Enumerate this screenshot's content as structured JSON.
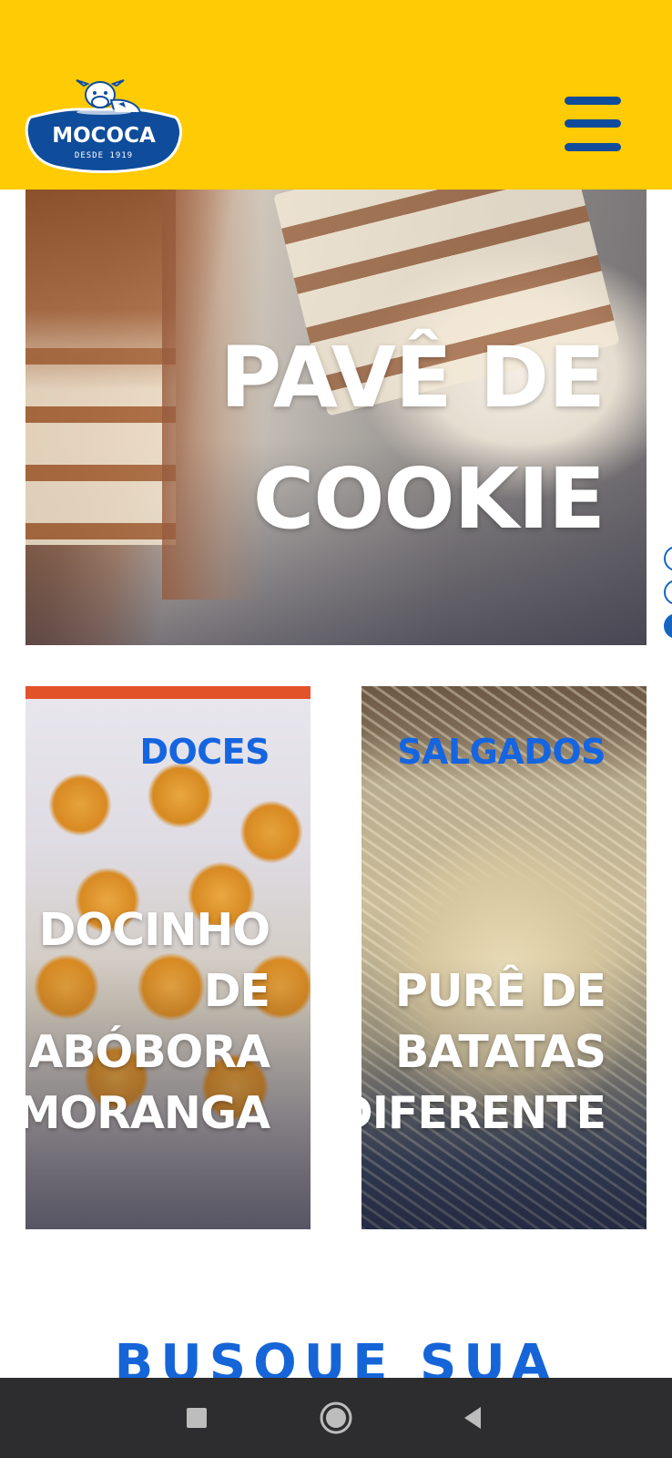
{
  "header": {
    "logo": {
      "brand": "MOCOCA",
      "tagline": "DESDE 1919",
      "icon": "cow-mascot-icon"
    },
    "menu_icon": "hamburger-menu-icon",
    "background_color": "#FFCB05",
    "accent_color": "#0F4C9B"
  },
  "hero": {
    "title": "PAVÊ DE COOKIE",
    "slider": {
      "total_dots": 3,
      "active_index": 2,
      "color": "#1565C0"
    }
  },
  "categories": [
    {
      "category": "DOCES",
      "title": "DOCINHO\nDE\nABÓBORA\nMORANGA"
    },
    {
      "category": "SALGADOS",
      "title": "PURÊ DE\nBATATAS\nDIFERENTE"
    }
  ],
  "section": {
    "heading": "BUSQUE SUA"
  },
  "system_nav": {
    "recents_icon": "square-recents-icon",
    "home_icon": "circle-home-icon",
    "back_icon": "triangle-back-icon"
  }
}
